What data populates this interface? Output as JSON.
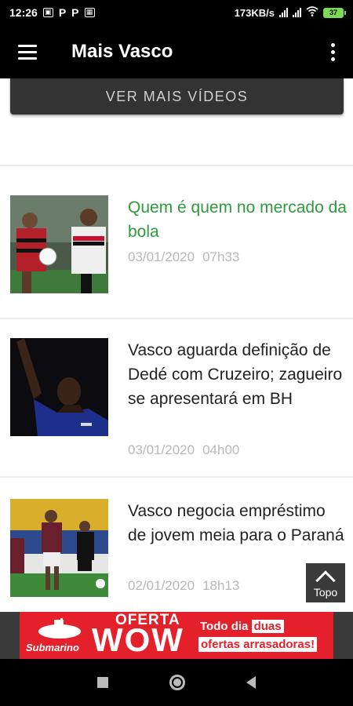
{
  "status_bar": {
    "time": "12:26",
    "notification_icons": [
      "gallery-icon",
      "p-icon",
      "p-icon",
      "square-icon"
    ],
    "p_label": "P",
    "network_speed": "173KB/s",
    "battery_level": "37"
  },
  "app_bar": {
    "title": "Mais Vasco"
  },
  "more_videos_label": "VER MAIS VÍDEOS",
  "news": [
    {
      "title": "Quem é quem no mercado da bola",
      "date": "03/01/2020",
      "time": "07h33",
      "visited": true,
      "thumb_desc": "players-photo"
    },
    {
      "title": "Vasco aguarda definição de Dedé com Cruzeiro; zagueiro se apresentará em BH",
      "date": "03/01/2020",
      "time": "04h00",
      "visited": false,
      "thumb_desc": "player-photo"
    },
    {
      "title": "Vasco negocia empréstimo de jovem meia para o Paraná",
      "date": "02/01/2020",
      "time": "18h13",
      "visited": false,
      "thumb_desc": "match-photo"
    }
  ],
  "topo_label": "Topo",
  "ad": {
    "brand": "Submarino",
    "oferta": "OFERTA",
    "wow": "WOW",
    "todo_dia": "Todo dia",
    "duas": "duas",
    "ofertas": "ofertas arrasadoras!",
    "colors": {
      "background": "#e4202a",
      "text": "#ffffff"
    }
  },
  "colors": {
    "app_bar": "#000000",
    "visited_title": "#2e9a3e",
    "meta_text": "#b8b8b8"
  }
}
